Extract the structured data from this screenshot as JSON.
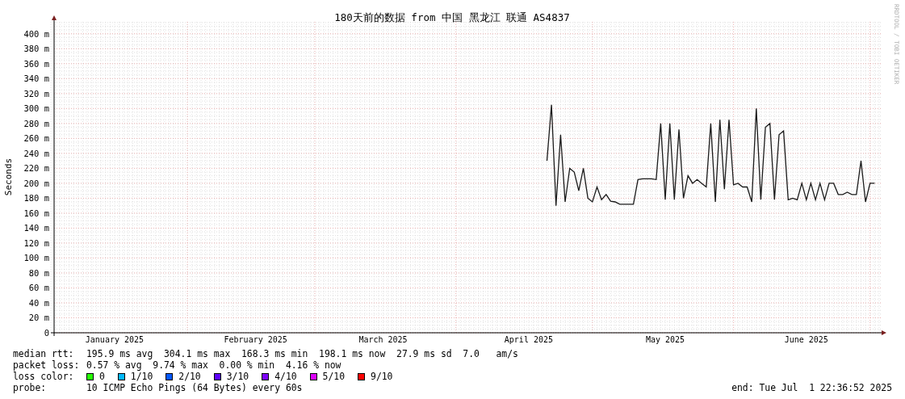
{
  "chart": {
    "chart_data": {
      "type": "line",
      "title": "180天前的数据 from 中国 黑龙江 联通 AS4837",
      "ylabel": "Seconds",
      "grid": true,
      "ylim": [
        0,
        416
      ],
      "yticks": [
        {
          "value": 0,
          "label": "0"
        },
        {
          "value": 20,
          "label": "20 m"
        },
        {
          "value": 40,
          "label": "40 m"
        },
        {
          "value": 60,
          "label": "60 m"
        },
        {
          "value": 80,
          "label": "80 m"
        },
        {
          "value": 100,
          "label": "100 m"
        },
        {
          "value": 120,
          "label": "120 m"
        },
        {
          "value": 140,
          "label": "140 m"
        },
        {
          "value": 160,
          "label": "160 m"
        },
        {
          "value": 180,
          "label": "180 m"
        },
        {
          "value": 200,
          "label": "200 m"
        },
        {
          "value": 220,
          "label": "220 m"
        },
        {
          "value": 240,
          "label": "240 m"
        },
        {
          "value": 260,
          "label": "260 m"
        },
        {
          "value": 280,
          "label": "280 m"
        },
        {
          "value": 300,
          "label": "300 m"
        },
        {
          "value": 320,
          "label": "320 m"
        },
        {
          "value": 340,
          "label": "340 m"
        },
        {
          "value": 360,
          "label": "360 m"
        },
        {
          "value": 380,
          "label": "380 m"
        },
        {
          "value": 400,
          "label": "400 m"
        }
      ],
      "categories": [
        null,
        null,
        null,
        null,
        null,
        null,
        null,
        null,
        null,
        null,
        null,
        null,
        null,
        null,
        "January 2025",
        null,
        null,
        null,
        null,
        null,
        null,
        null,
        null,
        null,
        null,
        null,
        null,
        null,
        null,
        null,
        null,
        null,
        null,
        null,
        null,
        null,
        null,
        null,
        null,
        null,
        null,
        null,
        null,
        null,
        null,
        "February 2025",
        null,
        null,
        null,
        null,
        null,
        null,
        null,
        null,
        null,
        null,
        null,
        null,
        null,
        null,
        null,
        null,
        null,
        null,
        null,
        null,
        null,
        null,
        null,
        null,
        null,
        null,
        null,
        "March 2025",
        null,
        null,
        null,
        null,
        null,
        null,
        null,
        null,
        null,
        null,
        null,
        null,
        null,
        null,
        null,
        null,
        null,
        null,
        null,
        null,
        null,
        null,
        null,
        null,
        null,
        null,
        null,
        null,
        null,
        null,
        null,
        "April 2025",
        null,
        null,
        null,
        null,
        null,
        null,
        null,
        null,
        null,
        null,
        null,
        null,
        null,
        null,
        null,
        null,
        null,
        null,
        null,
        null,
        null,
        null,
        null,
        null,
        null,
        null,
        null,
        null,
        null,
        "May 2025",
        null,
        null,
        null,
        null,
        null,
        null,
        null,
        null,
        null,
        null,
        null,
        null,
        null,
        null,
        null,
        null,
        null,
        null,
        null,
        null,
        null,
        null,
        null,
        null,
        null,
        null,
        null,
        null,
        null,
        null,
        "June 2025",
        null,
        null,
        null,
        null,
        null,
        null,
        null,
        null,
        null,
        null,
        null,
        null,
        null,
        null,
        null
      ],
      "series": [
        {
          "color": "#1a1a1a",
          "values": [
            null,
            null,
            null,
            null,
            null,
            null,
            null,
            null,
            null,
            null,
            null,
            null,
            null,
            null,
            null,
            null,
            null,
            null,
            null,
            null,
            null,
            null,
            null,
            null,
            null,
            null,
            null,
            null,
            null,
            null,
            null,
            null,
            null,
            null,
            null,
            null,
            null,
            null,
            null,
            null,
            null,
            null,
            null,
            null,
            null,
            null,
            null,
            null,
            null,
            null,
            null,
            null,
            null,
            null,
            null,
            null,
            null,
            null,
            null,
            null,
            null,
            null,
            null,
            null,
            null,
            null,
            null,
            null,
            null,
            null,
            null,
            null,
            null,
            null,
            null,
            null,
            null,
            null,
            null,
            null,
            null,
            null,
            null,
            null,
            null,
            null,
            null,
            null,
            null,
            null,
            null,
            null,
            null,
            null,
            null,
            null,
            null,
            null,
            null,
            null,
            null,
            null,
            null,
            null,
            null,
            null,
            null,
            null,
            null,
            230,
            305,
            170,
            265,
            175,
            220,
            215,
            190,
            220,
            180,
            175,
            195,
            178,
            185,
            176,
            175,
            172,
            172,
            172,
            172,
            205,
            206,
            206,
            206,
            205,
            280,
            178,
            280,
            178,
            272,
            180,
            210,
            200,
            205,
            200,
            195,
            280,
            175,
            285,
            192,
            285,
            198,
            200,
            195,
            195,
            175,
            300,
            178,
            275,
            280,
            178,
            265,
            270,
            178,
            180,
            178,
            200,
            178,
            200,
            178,
            200,
            178,
            200,
            200,
            185,
            185,
            188,
            185,
            185,
            230,
            175,
            200,
            200
          ]
        }
      ]
    },
    "credit": "RRDTOOL / TOBI OETIKER"
  },
  "legend": [
    {
      "label": "median rtt:",
      "text": "195.9 ms avg  304.1 ms max  168.3 ms min  198.1 ms now  27.9 ms sd  7.0   am/s"
    },
    {
      "label": "packet loss:",
      "text": "0.57 % avg  9.74 % max  0.00 % min  4.16 % now"
    }
  ],
  "loss_colors": {
    "label": "loss color:",
    "items": [
      {
        "label": "0",
        "color": "#26ff00"
      },
      {
        "label": "1/10",
        "color": "#00b8ff"
      },
      {
        "label": "2/10",
        "color": "#0059ff"
      },
      {
        "label": "3/10",
        "color": "#5e00ff"
      },
      {
        "label": "4/10",
        "color": "#7e00ff"
      },
      {
        "label": "5/10",
        "color": "#dd00ff"
      },
      {
        "label": "9/10",
        "color": "#ff0000"
      }
    ]
  },
  "probe": {
    "label": "probe:",
    "text": "10 ICMP Echo Pings (64 Bytes) every 60s",
    "end": "end: Tue Jul  1 22:36:52 2025"
  }
}
